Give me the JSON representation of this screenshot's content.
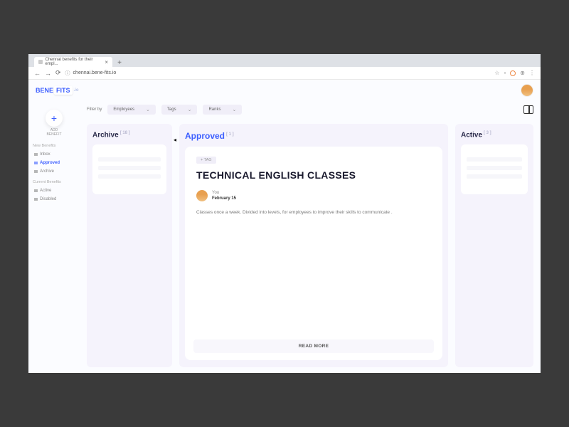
{
  "browser": {
    "tab_title": "Chennai benefits for their empl...",
    "url": "chennai.bene-fits.io"
  },
  "logo": {
    "part1": "BENE",
    "part2": "FITS",
    "suffix": ".io"
  },
  "sidebar": {
    "add_label": "ADD\nBENEFIT",
    "groups": [
      {
        "label": "New Benefits",
        "items": [
          {
            "label": "Inbox",
            "active": false
          },
          {
            "label": "Approved",
            "active": true
          },
          {
            "label": "Archive",
            "active": false
          }
        ]
      },
      {
        "label": "Current Benefits",
        "items": [
          {
            "label": "Active",
            "active": false
          },
          {
            "label": "Disabled",
            "active": false
          }
        ]
      }
    ]
  },
  "filters": {
    "label": "Filter by",
    "options": [
      "Employees",
      "Tags",
      "Ranks"
    ]
  },
  "columns": {
    "archive": {
      "title": "Archive",
      "count": "[ 18 ]"
    },
    "approved": {
      "title": "Approved",
      "count": "[ 1 ]"
    },
    "active": {
      "title": "Active",
      "count": "[ 3 ]"
    }
  },
  "card": {
    "tag": "+ TAG",
    "title": "TECHNICAL ENGLISH CLASSES",
    "author_name": "You",
    "author_date": "February 15",
    "description": "Classes once a week. Divided into levels, for employees to improve their skills to communicate .",
    "read_more": "READ MORE"
  }
}
